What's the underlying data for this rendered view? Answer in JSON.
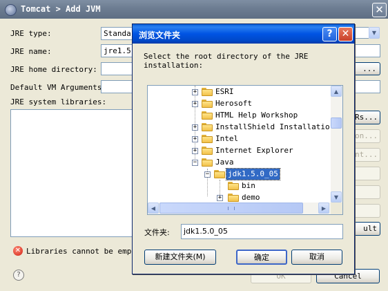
{
  "back_window": {
    "title": "Tomcat > Add JVM",
    "close_glyph": "✕",
    "labels": {
      "jre_type": "JRE type:",
      "jre_name": "JRE name:",
      "jre_home": "JRE home directory:",
      "default_vm_args": "Default VM Arguments:",
      "jre_libs": "JRE system libraries:"
    },
    "jre_type_value": "Standar",
    "jre_name_value": "jre1.5",
    "browse_button": "...",
    "right_buttons": [
      "Rs...",
      "on...",
      "nt...",
      "ult"
    ],
    "error_message": "Libraries cannot be empty",
    "ok_button": "OK",
    "cancel_button": "Cancel"
  },
  "dialog": {
    "title": "浏览文件夹",
    "help_glyph": "?",
    "close_glyph": "✕",
    "instruction": "Select the root directory of the JRE installation:",
    "tree": [
      {
        "label": "ESRI",
        "expander": "+",
        "depth": 0
      },
      {
        "label": "Herosoft",
        "expander": "+",
        "depth": 0
      },
      {
        "label": "HTML Help Workshop",
        "expander": "",
        "depth": 0
      },
      {
        "label": "InstallShield Installation I",
        "expander": "+",
        "depth": 0
      },
      {
        "label": "Intel",
        "expander": "+",
        "depth": 0
      },
      {
        "label": "Internet Explorer",
        "expander": "+",
        "depth": 0
      },
      {
        "label": "Java",
        "expander": "−",
        "depth": 0
      },
      {
        "label": "jdk1.5.0_05",
        "expander": "−",
        "depth": 1,
        "selected": true
      },
      {
        "label": "bin",
        "expander": "",
        "depth": 2
      },
      {
        "label": "demo",
        "expander": "+",
        "depth": 2
      }
    ],
    "folder_label": "文件夹:",
    "folder_value": "jdk1.5.0_05",
    "new_folder_button": "新建文件夹(M)",
    "ok_button": "确定",
    "cancel_button": "取消"
  }
}
